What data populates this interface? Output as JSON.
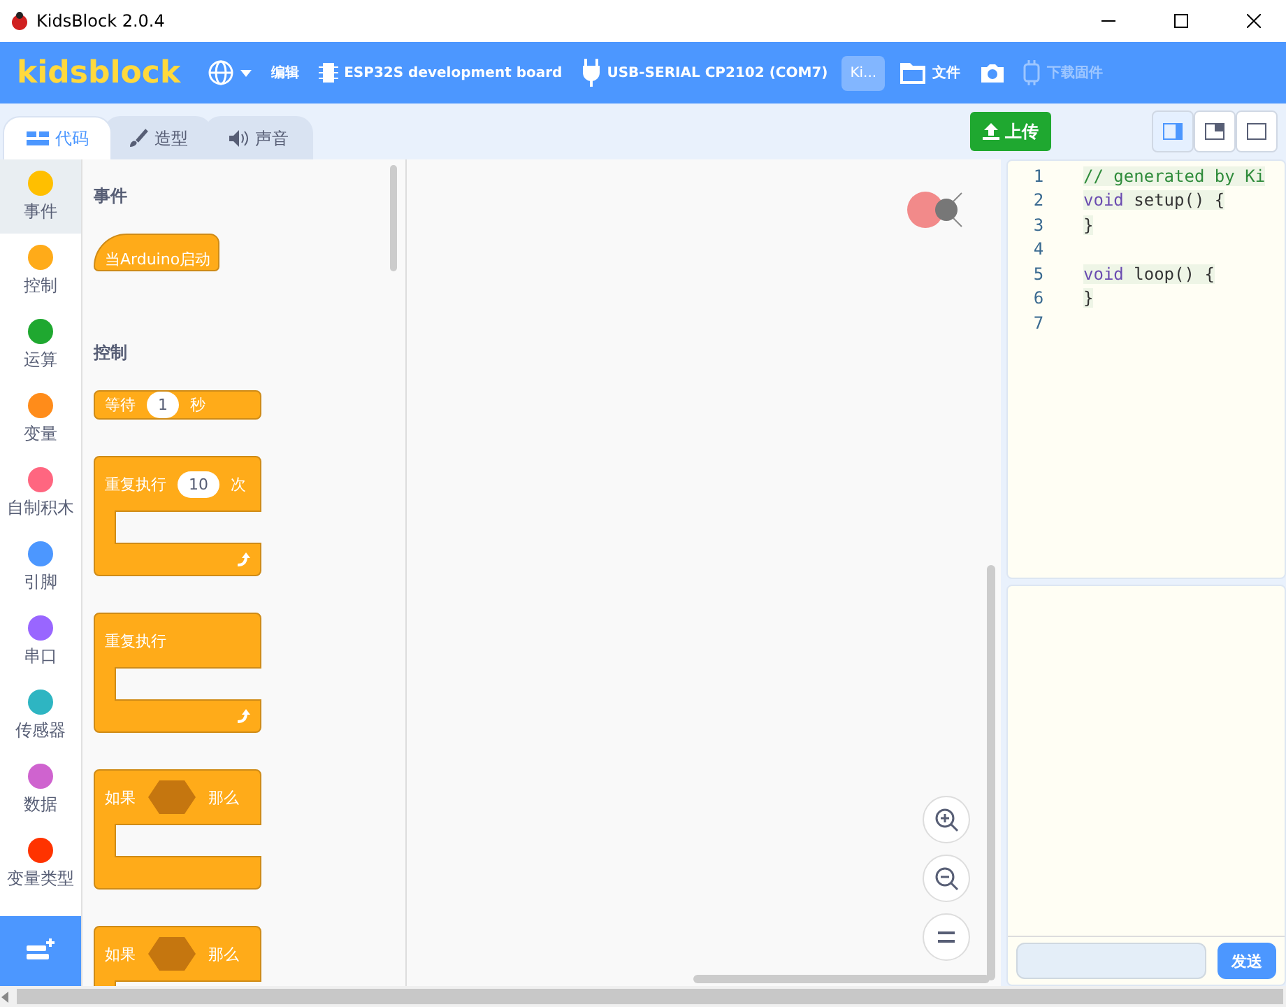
{
  "window": {
    "title": "KidsBlock 2.0.4"
  },
  "menu_bar": {
    "logo": "kidsblock",
    "edit": "编辑",
    "board": "ESP32S development board",
    "port": "USB-SERIAL CP2102 (COM7)",
    "account": "Ki...",
    "file": "文件",
    "firmware": "下载固件"
  },
  "tabs": [
    {
      "label": "代码",
      "selected": true
    },
    {
      "label": "造型",
      "selected": false
    },
    {
      "label": "声音",
      "selected": false
    }
  ],
  "upload_button": "上传",
  "layout_buttons": [
    {
      "selected": true
    },
    {
      "selected": false
    },
    {
      "selected": false
    }
  ],
  "categories": [
    {
      "label": "事件",
      "color": "#ffbf00",
      "selected": true
    },
    {
      "label": "控制",
      "color": "#ffab19",
      "selected": false
    },
    {
      "label": "运算",
      "color": "#1fa830",
      "selected": false
    },
    {
      "label": "变量",
      "color": "#ff8c1a",
      "selected": false
    },
    {
      "label": "自制积木",
      "color": "#ff6680",
      "selected": false
    },
    {
      "label": "引脚",
      "color": "#4c97ff",
      "selected": false
    },
    {
      "label": "串口",
      "color": "#9966ff",
      "selected": false
    },
    {
      "label": "传感器",
      "color": "#2eb5c2",
      "selected": false
    },
    {
      "label": "数据",
      "color": "#cf63cf",
      "selected": false
    },
    {
      "label": "变量类型",
      "color": "#ff3300",
      "selected": false
    }
  ],
  "flyout": [
    {
      "title": "事件",
      "blocks": [
        {
          "kind": "hat",
          "parts": [
            {
              "kind": "text",
              "text": "当Arduino启动"
            }
          ]
        }
      ]
    },
    {
      "title": "控制",
      "blocks": [
        {
          "kind": "stack",
          "parts": [
            {
              "kind": "text",
              "text": "等待"
            },
            {
              "kind": "number",
              "text": "1"
            },
            {
              "kind": "text",
              "text": "秒"
            }
          ]
        },
        {
          "kind": "c",
          "loop": true,
          "parts": [
            {
              "kind": "text",
              "text": "重复执行"
            },
            {
              "kind": "number",
              "text": "10"
            },
            {
              "kind": "text",
              "text": "次"
            }
          ]
        },
        {
          "kind": "c",
          "loop": true,
          "parts": [
            {
              "kind": "text",
              "text": "重复执行"
            }
          ]
        },
        {
          "kind": "c",
          "loop": false,
          "parts": [
            {
              "kind": "text",
              "text": "如果"
            },
            {
              "kind": "condition"
            },
            {
              "kind": "text",
              "text": "那么"
            }
          ]
        },
        {
          "kind": "c",
          "parts": [
            {
              "kind": "text",
              "text": "如果"
            },
            {
              "kind": "condition"
            },
            {
              "kind": "text",
              "text": "那么"
            }
          ]
        }
      ]
    }
  ],
  "code": [
    {
      "number": "1",
      "segments": [
        {
          "kind": "comment",
          "text": "// generated by Ki"
        }
      ]
    },
    {
      "number": "2",
      "segments": [
        {
          "kind": "keyword",
          "text": "void"
        },
        {
          "kind": "plain",
          "text": " setup() {"
        }
      ]
    },
    {
      "number": "3",
      "segments": [
        {
          "kind": "plain",
          "text": "}"
        }
      ]
    },
    {
      "number": "4"
    },
    {
      "number": "5",
      "segments": [
        {
          "kind": "keyword",
          "text": "void"
        },
        {
          "kind": "plain",
          "text": " loop() {"
        }
      ]
    },
    {
      "number": "6",
      "segments": [
        {
          "kind": "plain",
          "text": "}"
        }
      ]
    },
    {
      "number": "7"
    }
  ],
  "serial": {
    "send_button": "发送"
  }
}
